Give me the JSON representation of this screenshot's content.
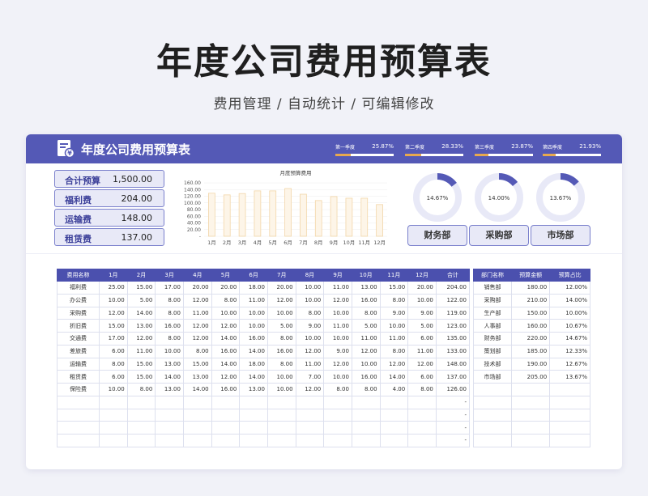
{
  "page": {
    "title": "年度公司费用预算表",
    "subtitle": "费用管理 / 自动统计 / 可编辑修改"
  },
  "header": {
    "title": "年度公司费用预算表",
    "quarters": [
      {
        "label": "第一季度",
        "value": "25.87%",
        "fill": 0.2587
      },
      {
        "label": "第二季度",
        "value": "28.33%",
        "fill": 0.2833
      },
      {
        "label": "第三季度",
        "value": "23.87%",
        "fill": 0.2387
      },
      {
        "label": "第四季度",
        "value": "21.93%",
        "fill": 0.2193
      }
    ]
  },
  "summary": [
    {
      "label": "合计预算",
      "value": "1,500.00"
    },
    {
      "label": "福利费",
      "value": "204.00"
    },
    {
      "label": "运输费",
      "value": "148.00"
    },
    {
      "label": "租赁费",
      "value": "137.00"
    }
  ],
  "chart_data": [
    {
      "type": "bar",
      "title": "月度预算费用",
      "categories": [
        "1月",
        "2月",
        "3月",
        "4月",
        "5月",
        "6月",
        "7月",
        "8月",
        "9月",
        "10月",
        "11月",
        "12月"
      ],
      "values": [
        129,
        124,
        128,
        136,
        136,
        143,
        126,
        107,
        119,
        114,
        114,
        95
      ],
      "ylim": [
        0,
        160
      ],
      "yticks": [
        "160.00",
        "140.00",
        "120.00",
        "100.00",
        "80.00",
        "60.00",
        "40.00",
        "20.00",
        "-"
      ],
      "colors": {
        "fill": "#fdf5e8",
        "stroke": "#f2d6a8"
      }
    },
    {
      "type": "pie",
      "label": "14.67%",
      "value": 14.67,
      "department": "财务部"
    },
    {
      "type": "pie",
      "label": "14.00%",
      "value": 14.0,
      "department": "采购部"
    },
    {
      "type": "pie",
      "label": "13.67%",
      "value": 13.67,
      "department": "市场部"
    }
  ],
  "colors": {
    "accent": "#5459b6",
    "ring": "#e8e9f7",
    "ring_fill": "#5459b6",
    "quarter": "#e7a84e"
  },
  "monthly_table": {
    "headers": [
      "费用名称",
      "1月",
      "2月",
      "3月",
      "4月",
      "5月",
      "6月",
      "7月",
      "8月",
      "9月",
      "10月",
      "11月",
      "12月",
      "合计"
    ],
    "rows": [
      [
        "福利费",
        "25.00",
        "15.00",
        "17.00",
        "20.00",
        "20.00",
        "18.00",
        "20.00",
        "10.00",
        "11.00",
        "13.00",
        "15.00",
        "20.00",
        "204.00"
      ],
      [
        "办公费",
        "10.00",
        "5.00",
        "8.00",
        "12.00",
        "8.00",
        "11.00",
        "12.00",
        "10.00",
        "12.00",
        "16.00",
        "8.00",
        "10.00",
        "122.00"
      ],
      [
        "采购费",
        "12.00",
        "14.00",
        "8.00",
        "11.00",
        "10.00",
        "10.00",
        "10.00",
        "8.00",
        "10.00",
        "8.00",
        "9.00",
        "9.00",
        "119.00"
      ],
      [
        "折旧费",
        "15.00",
        "13.00",
        "16.00",
        "12.00",
        "12.00",
        "10.00",
        "5.00",
        "9.00",
        "11.00",
        "5.00",
        "10.00",
        "5.00",
        "123.00"
      ],
      [
        "交通费",
        "17.00",
        "12.00",
        "8.00",
        "12.00",
        "14.00",
        "16.00",
        "8.00",
        "10.00",
        "10.00",
        "11.00",
        "11.00",
        "6.00",
        "135.00"
      ],
      [
        "差旅费",
        "6.00",
        "11.00",
        "10.00",
        "8.00",
        "16.00",
        "14.00",
        "16.00",
        "12.00",
        "9.00",
        "12.00",
        "8.00",
        "11.00",
        "133.00"
      ],
      [
        "运输费",
        "8.00",
        "15.00",
        "13.00",
        "15.00",
        "14.00",
        "18.00",
        "8.00",
        "11.00",
        "12.00",
        "10.00",
        "12.00",
        "12.00",
        "148.00"
      ],
      [
        "租赁费",
        "6.00",
        "15.00",
        "14.00",
        "13.00",
        "12.00",
        "14.00",
        "10.00",
        "7.00",
        "10.00",
        "16.00",
        "14.00",
        "6.00",
        "137.00"
      ],
      [
        "保险费",
        "10.00",
        "8.00",
        "13.00",
        "14.00",
        "16.00",
        "13.00",
        "10.00",
        "12.00",
        "8.00",
        "8.00",
        "4.00",
        "8.00",
        "126.00"
      ],
      [
        "",
        "",
        "",
        "",
        "",
        "",
        "",
        "",
        "",
        "",
        "",
        "",
        "",
        "-"
      ],
      [
        "",
        "",
        "",
        "",
        "",
        "",
        "",
        "",
        "",
        "",
        "",
        "",
        "",
        "-"
      ],
      [
        "",
        "",
        "",
        "",
        "",
        "",
        "",
        "",
        "",
        "",
        "",
        "",
        "",
        "-"
      ],
      [
        "",
        "",
        "",
        "",
        "",
        "",
        "",
        "",
        "",
        "",
        "",
        "",
        "",
        "-"
      ]
    ]
  },
  "dept_table": {
    "headers": [
      "部门名称",
      "预算金额",
      "预算占比"
    ],
    "rows": [
      [
        "销售部",
        "180.00",
        "12.00%"
      ],
      [
        "采购部",
        "210.00",
        "14.00%"
      ],
      [
        "生产部",
        "150.00",
        "10.00%"
      ],
      [
        "人事部",
        "160.00",
        "10.67%"
      ],
      [
        "财务部",
        "220.00",
        "14.67%"
      ],
      [
        "策划部",
        "185.00",
        "12.33%"
      ],
      [
        "技术部",
        "190.00",
        "12.67%"
      ],
      [
        "市场部",
        "205.00",
        "13.67%"
      ],
      [
        "",
        "",
        ""
      ],
      [
        "",
        "",
        ""
      ],
      [
        "",
        "",
        ""
      ],
      [
        "",
        "",
        ""
      ],
      [
        "",
        "",
        ""
      ]
    ]
  }
}
